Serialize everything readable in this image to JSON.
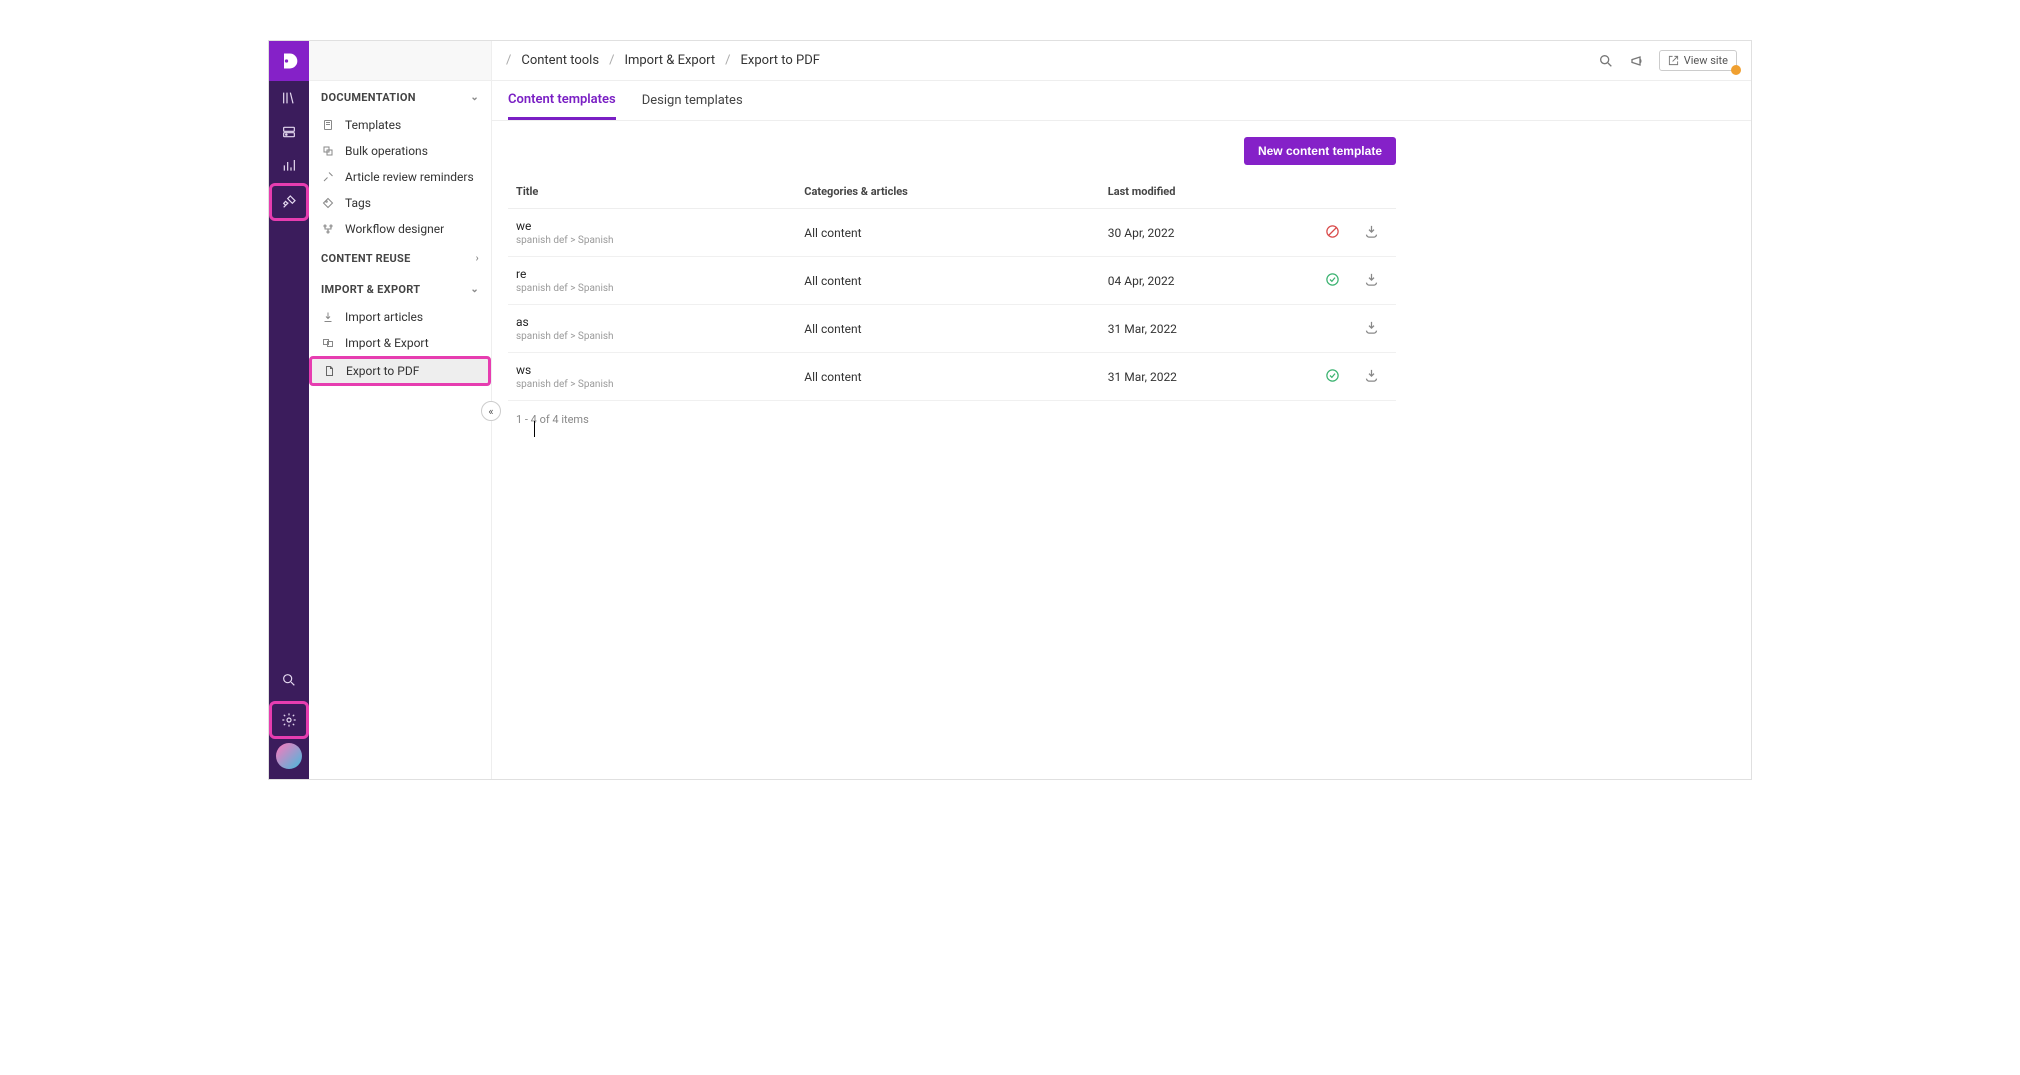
{
  "breadcrumb": [
    "Content tools",
    "Import & Export",
    "Export to PDF"
  ],
  "topbar": {
    "view_site": "View site"
  },
  "sidebar": {
    "sections": {
      "documentation": {
        "label": "DOCUMENTATION",
        "items": [
          {
            "label": "Templates"
          },
          {
            "label": "Bulk operations"
          },
          {
            "label": "Article review reminders"
          },
          {
            "label": "Tags"
          },
          {
            "label": "Workflow designer"
          }
        ]
      },
      "content_reuse": {
        "label": "CONTENT REUSE"
      },
      "import_export": {
        "label": "IMPORT & EXPORT",
        "items": [
          {
            "label": "Import articles"
          },
          {
            "label": "Import & Export"
          },
          {
            "label": "Export to PDF",
            "active": true
          }
        ]
      }
    }
  },
  "tabs": [
    {
      "label": "Content templates",
      "active": true
    },
    {
      "label": "Design templates",
      "active": false
    }
  ],
  "action_button": "New content template",
  "table": {
    "headers": [
      "Title",
      "Categories & articles",
      "Last modified",
      "",
      ""
    ],
    "rows": [
      {
        "title": "we",
        "sub": "spanish def > Spanish",
        "categories": "All content",
        "modified": "30 Apr, 2022",
        "status": "blocked"
      },
      {
        "title": "re",
        "sub": "spanish def > Spanish",
        "categories": "All content",
        "modified": "04 Apr, 2022",
        "status": "ok"
      },
      {
        "title": "as",
        "sub": "spanish def > Spanish",
        "categories": "All content",
        "modified": "31 Mar, 2022",
        "status": "none"
      },
      {
        "title": "ws",
        "sub": "spanish def > Spanish",
        "categories": "All content",
        "modified": "31 Mar, 2022",
        "status": "ok"
      }
    ],
    "pager": "1 - 4 of 4 items"
  }
}
